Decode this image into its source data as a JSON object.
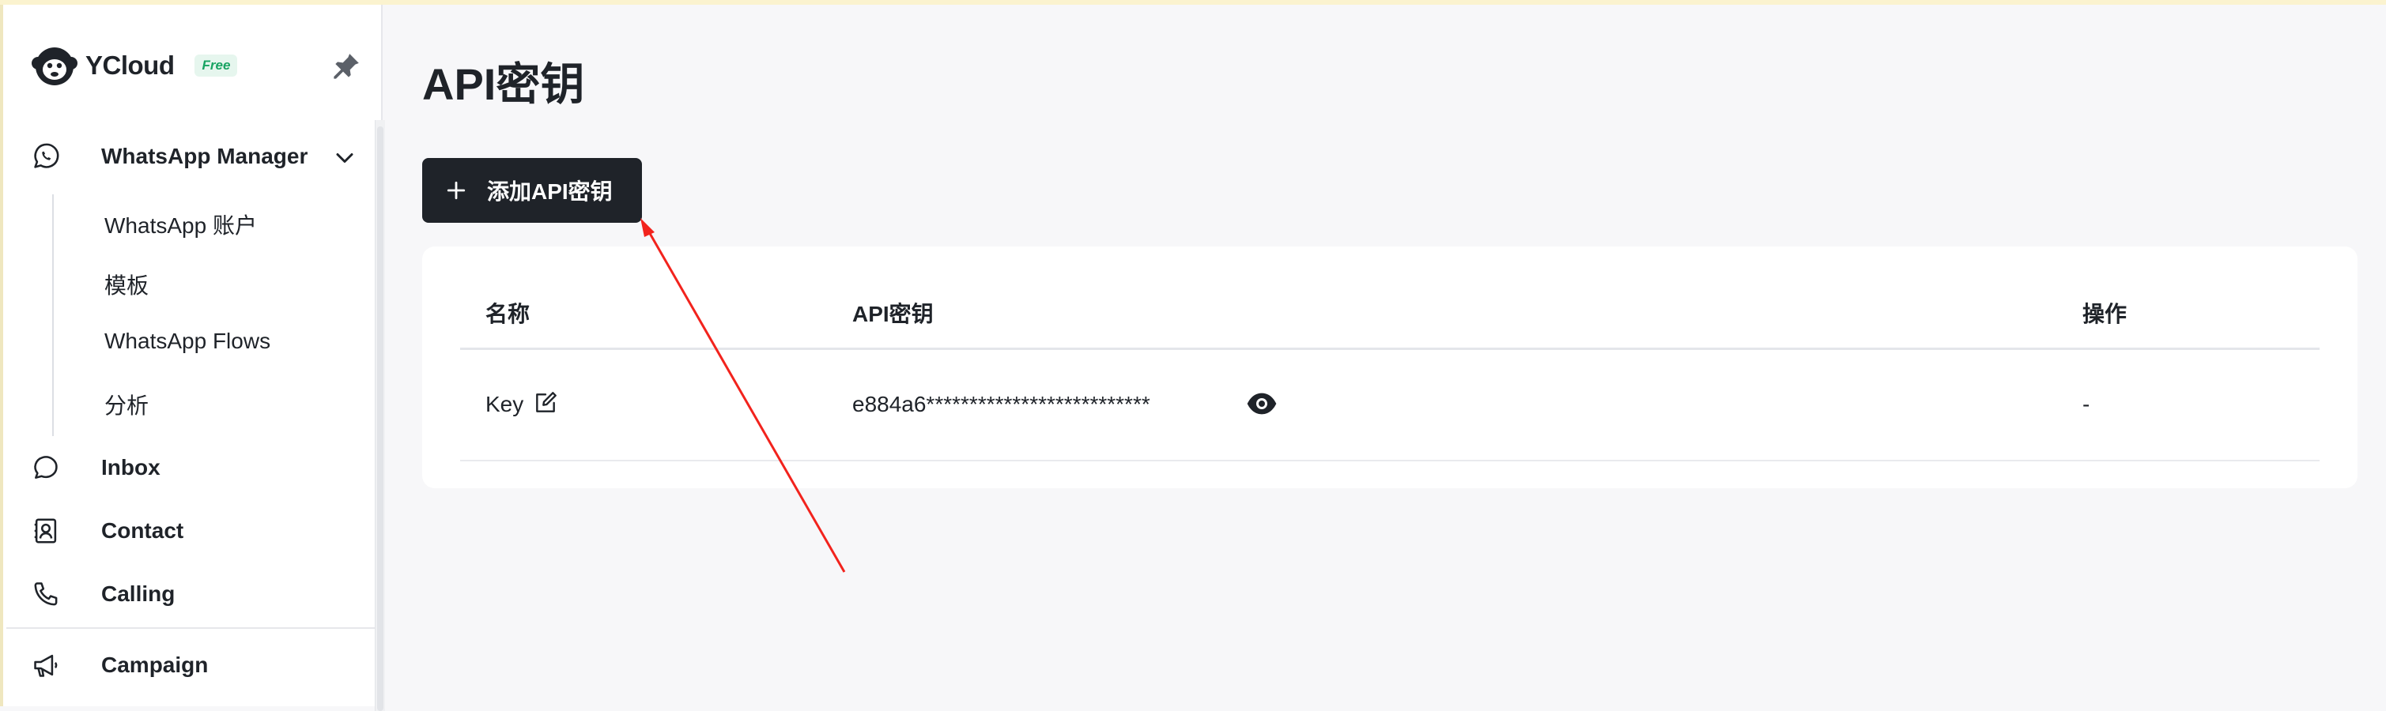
{
  "brand": {
    "name": "YCloud",
    "plan_badge": "Free"
  },
  "sidebar": {
    "whatsapp_manager": {
      "label": "WhatsApp Manager",
      "icon": "whatsapp-icon",
      "expanded": true,
      "children": [
        {
          "label": "WhatsApp 账户"
        },
        {
          "label": "模板"
        },
        {
          "label": "WhatsApp Flows"
        },
        {
          "label": "分析"
        }
      ]
    },
    "items": [
      {
        "label": "Inbox",
        "icon": "chat-bubble-icon"
      },
      {
        "label": "Contact",
        "icon": "contact-card-icon"
      },
      {
        "label": "Calling",
        "icon": "phone-icon"
      },
      {
        "label": "Campaign",
        "icon": "megaphone-icon"
      }
    ]
  },
  "main": {
    "title": "API密钥",
    "add_button_label": "添加API密钥",
    "table": {
      "columns": [
        "名称",
        "API密钥",
        "操作"
      ],
      "rows": [
        {
          "name": "Key",
          "api_key": "e884a6**************************",
          "action": "-"
        }
      ]
    }
  },
  "colors": {
    "primary_dark": "#1f2329",
    "free_badge_text": "#19a463",
    "free_badge_bg": "#e6f6ee",
    "annotation_arrow": "#f2231d"
  }
}
